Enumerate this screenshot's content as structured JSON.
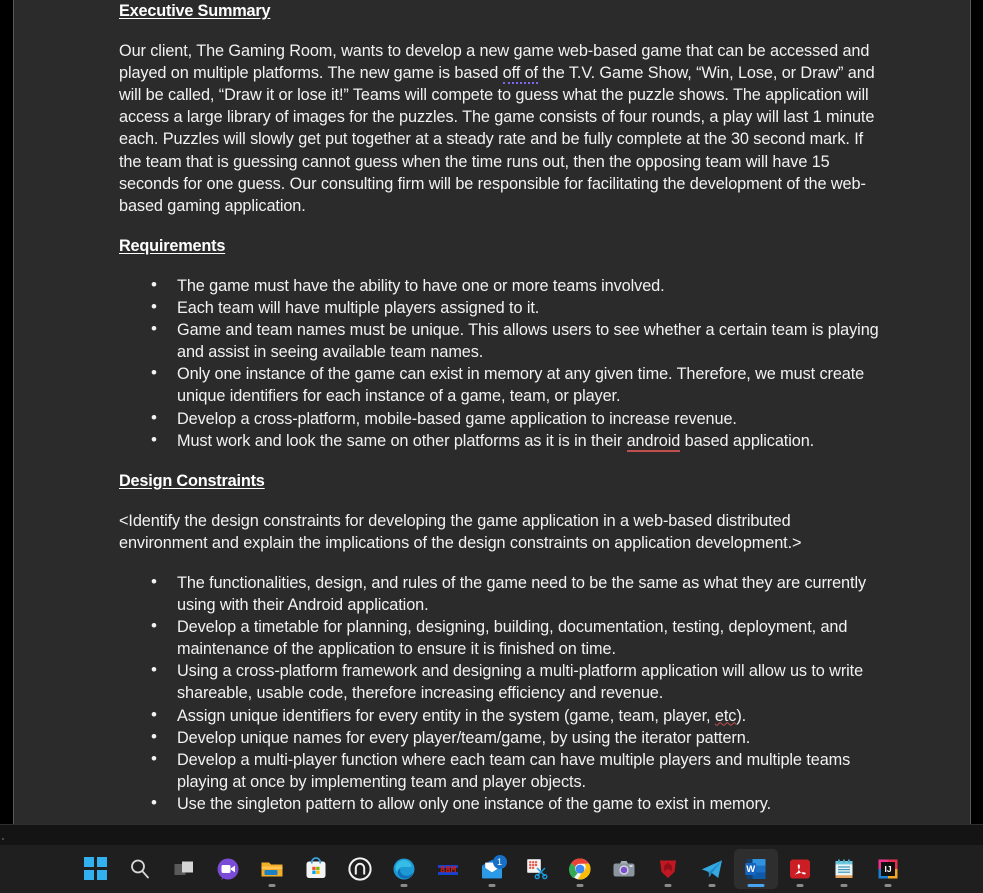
{
  "document": {
    "sections": [
      {
        "heading": "Executive Summary",
        "paragraphs": [
          {
            "runs": [
              {
                "t": "Our client, The Gaming Room, wants to develop a new game web-based game that can be accessed and played on multiple platforms. The new game is based "
              },
              {
                "t": "off of",
                "mark": "grammar"
              },
              {
                "t": " the T.V. Game Show, “Win, Lose, or Draw” and will be called, “Draw it or lose it!” Teams will compete to guess what the puzzle shows. The application will access a large library of images for the puzzles.  The game consists of four rounds, a play will last 1 minute each. Puzzles will slowly get put together at a steady rate and be fully complete at the 30 second mark. If the team that is guessing cannot guess when the time runs out, then the opposing team will have 15 seconds for one guess. Our consulting firm will be responsible for facilitating the development of the web-based gaming application."
              }
            ]
          }
        ],
        "bullets": []
      },
      {
        "heading": "Requirements",
        "paragraphs": [],
        "bullets": [
          {
            "runs": [
              {
                "t": "The game must have the ability to have one or more teams involved."
              }
            ]
          },
          {
            "runs": [
              {
                "t": "Each team will have multiple players assigned to it."
              }
            ]
          },
          {
            "runs": [
              {
                "t": "Game and team names must be unique. This allows users to see whether a certain team is playing and assist in seeing available team names."
              }
            ]
          },
          {
            "runs": [
              {
                "t": "Only one instance of the game can exist in memory at any given time. Therefore, we must create unique identifiers for each instance of a game, team, or player."
              }
            ]
          },
          {
            "runs": [
              {
                "t": "Develop a cross-platform, mobile-based game application to increase revenue."
              }
            ]
          },
          {
            "runs": [
              {
                "t": "Must work and look the same on other platforms as it is in their "
              },
              {
                "t": "android",
                "mark": "spelling-solid"
              },
              {
                "t": " based application."
              }
            ]
          }
        ]
      },
      {
        "heading": "Design Constraints",
        "paragraphs": [
          {
            "runs": [
              {
                "t": "<Identify the design constraints for developing the game application in a web-based distributed environment and explain the implications of the design constraints on application development.>"
              }
            ]
          }
        ],
        "bullets": [
          {
            "runs": [
              {
                "t": "The functionalities, design, and rules of the game need to be the same as what they are currently using with their Android application."
              }
            ]
          },
          {
            "runs": [
              {
                "t": "Develop a timetable for planning, designing, building, documentation, testing, deployment, and maintenance of the application to ensure it is finished on time."
              }
            ]
          },
          {
            "runs": [
              {
                "t": "Using a cross-platform framework and designing a multi-platform application will allow us to write shareable, usable code, therefore increasing efficiency and revenue."
              }
            ]
          },
          {
            "runs": [
              {
                "t": "Assign unique identifiers for every entity in the system (game, team, player, "
              },
              {
                "t": "etc",
                "mark": "spelling"
              },
              {
                "t": ")."
              }
            ]
          },
          {
            "runs": [
              {
                "t": "Develop unique names for every player/team/game, by using the iterator pattern."
              }
            ]
          },
          {
            "runs": [
              {
                "t": "Develop a multi-player function where each team can have multiple players and multiple teams playing at once by implementing team and player objects."
              }
            ]
          },
          {
            "runs": [
              {
                "t": "Use the singleton pattern to allow only one instance of the game to exist in memory."
              }
            ]
          }
        ]
      }
    ],
    "colors": {
      "page_background": "#2b2b2b",
      "text": "#f2f2f2",
      "spelling_underline": "#c0504d",
      "grammar_underline": "#7b68ee",
      "canvas": "#000000"
    }
  },
  "taskbar": {
    "items": [
      {
        "name": "start-button",
        "icon": "windows-logo-icon",
        "label": "Start",
        "running": false,
        "active": false,
        "badge": null
      },
      {
        "name": "search-button",
        "icon": "search-icon",
        "label": "Search",
        "running": false,
        "active": false,
        "badge": null
      },
      {
        "name": "task-view-button",
        "icon": "task-view-icon",
        "label": "Task View",
        "running": false,
        "active": false,
        "badge": null
      },
      {
        "name": "chat-button",
        "icon": "chat-video-icon",
        "label": "Chat",
        "running": false,
        "active": false,
        "badge": null
      },
      {
        "name": "file-explorer-button",
        "icon": "folder-icon",
        "label": "File Explorer",
        "running": true,
        "active": false,
        "badge": null
      },
      {
        "name": "microsoft-store-button",
        "icon": "store-bag-icon",
        "label": "Microsoft Store",
        "running": false,
        "active": false,
        "badge": null
      },
      {
        "name": "app-circle-button",
        "icon": "circle-arch-icon",
        "label": "App",
        "running": false,
        "active": false,
        "badge": null
      },
      {
        "name": "edge-button",
        "icon": "edge-icon",
        "label": "Microsoft Edge",
        "running": true,
        "active": false,
        "badge": null
      },
      {
        "name": "digital-clock-button",
        "icon": "red-digital-icon",
        "label": "App",
        "running": false,
        "active": false,
        "badge": null
      },
      {
        "name": "mail-button",
        "icon": "mail-icon",
        "label": "Mail",
        "running": true,
        "active": false,
        "badge": "1"
      },
      {
        "name": "snipping-tool-button",
        "icon": "snipping-tool-icon",
        "label": "Snipping Tool",
        "running": false,
        "active": false,
        "badge": null
      },
      {
        "name": "chrome-button",
        "icon": "chrome-icon",
        "label": "Google Chrome",
        "running": true,
        "active": false,
        "badge": null
      },
      {
        "name": "camera-button",
        "icon": "camera-icon",
        "label": "Camera",
        "running": false,
        "active": false,
        "badge": null
      },
      {
        "name": "mcafee-button",
        "icon": "mcafee-shield-icon",
        "label": "McAfee",
        "running": true,
        "active": false,
        "badge": null
      },
      {
        "name": "telegram-button",
        "icon": "telegram-icon",
        "label": "Telegram",
        "running": true,
        "active": false,
        "badge": null
      },
      {
        "name": "word-button",
        "icon": "word-icon",
        "label": "Microsoft Word",
        "running": true,
        "active": true,
        "badge": null
      },
      {
        "name": "acrobat-button",
        "icon": "acrobat-icon",
        "label": "Adobe Acrobat",
        "running": true,
        "active": false,
        "badge": null
      },
      {
        "name": "notepad-button",
        "icon": "notepad-icon",
        "label": "Notepad",
        "running": true,
        "active": false,
        "badge": null
      },
      {
        "name": "intellij-button",
        "icon": "intellij-icon",
        "label": "IntelliJ IDEA",
        "running": true,
        "active": false,
        "badge": null
      }
    ],
    "colors": {
      "background": "#1f1f1f",
      "active_highlight": "#2e2e2e",
      "running_indicator": "#8a8a8a",
      "active_indicator": "#4aa3ef"
    }
  }
}
